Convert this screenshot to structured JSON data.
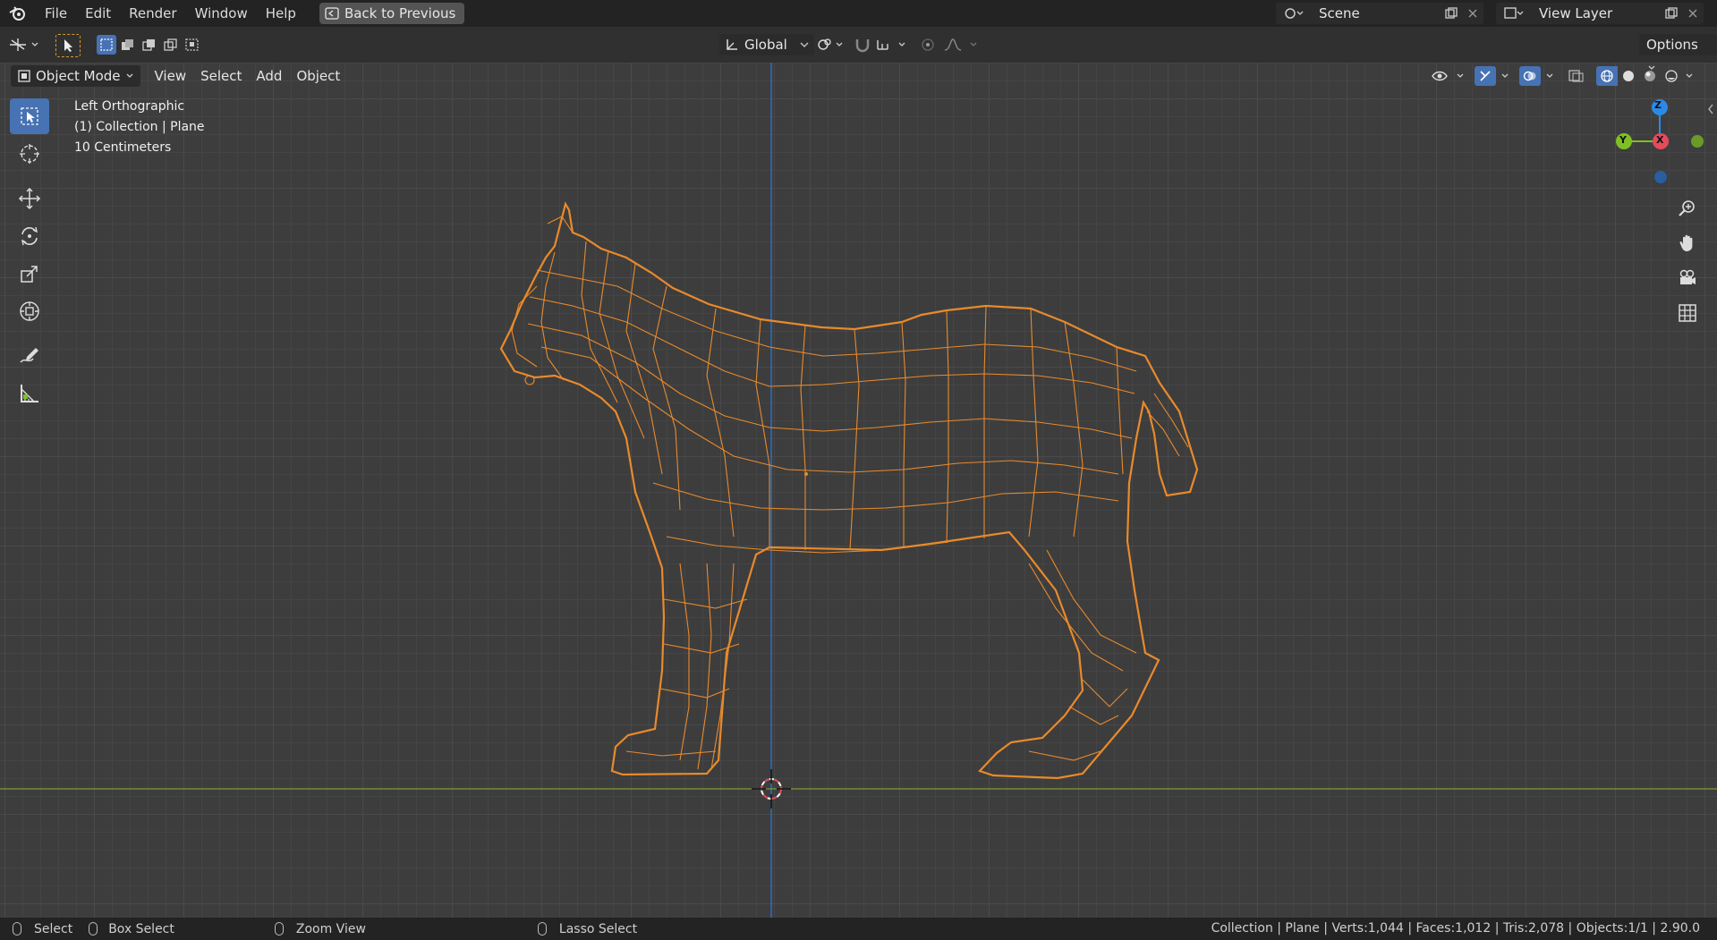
{
  "menubar": {
    "items": [
      "File",
      "Edit",
      "Render",
      "Window",
      "Help"
    ],
    "back_button": "Back to Previous",
    "scene": "Scene",
    "view_layer": "View Layer"
  },
  "toolheader": {
    "transform_orientation": "Global",
    "options": "Options"
  },
  "viewheader": {
    "mode": "Object Mode",
    "menus": [
      "View",
      "Select",
      "Add",
      "Object"
    ]
  },
  "overlay": {
    "view_name": "Left Orthographic",
    "collection": "(1) Collection | Plane",
    "scale": "10 Centimeters"
  },
  "gizmo": {
    "z": "Z",
    "y": "Y",
    "x": "X"
  },
  "statusbar": {
    "select": "Select",
    "box_select": "Box Select",
    "zoom_view": "Zoom View",
    "lasso_select": "Lasso Select",
    "stats": "Collection | Plane | Verts:1,044 | Faces:1,012 | Tris:2,078 | Objects:1/1 | 2.90.0"
  },
  "colors": {
    "accent": "#4772b3",
    "wire": "#e88a2c",
    "axis_x": "#e44b5b",
    "axis_y": "#7ec024",
    "axis_z": "#2b8ae6"
  }
}
